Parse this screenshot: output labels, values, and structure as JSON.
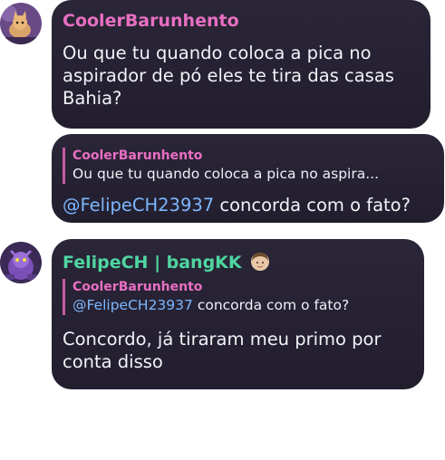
{
  "colors": {
    "bubble_bg": "#25212f",
    "name_pink": "#e86fc2",
    "name_green": "#4fd6a0",
    "mention_blue": "#7db7ff",
    "reply_bar": "#c65ca6"
  },
  "messages": [
    {
      "author": "CoolerBarunhento",
      "avatar_icon": "orange-cat-avatar",
      "text_line1": "Ou que tu quando coloca a pica no",
      "text_line2": "aspirador de pó eles te tira das casas",
      "text_line3": "Bahia?"
    },
    {
      "reply_author": "CoolerBarunhento",
      "reply_text": "Ou que tu quando coloca a pica no aspira...",
      "mention": "@FelipeCH23937",
      "text": " concorda com o fato?"
    },
    {
      "author": "FelipeCH | bangKK",
      "avatar_icon": "purple-creature-avatar",
      "name_badge_icon": "person-emoji-icon",
      "reply_author": "CoolerBarunhento",
      "reply_mention": "@FelipeCH23937",
      "reply_text": " concorda com o fato?",
      "text_line1": "Concordo, já tiraram meu primo por",
      "text_line2": "conta disso"
    }
  ]
}
